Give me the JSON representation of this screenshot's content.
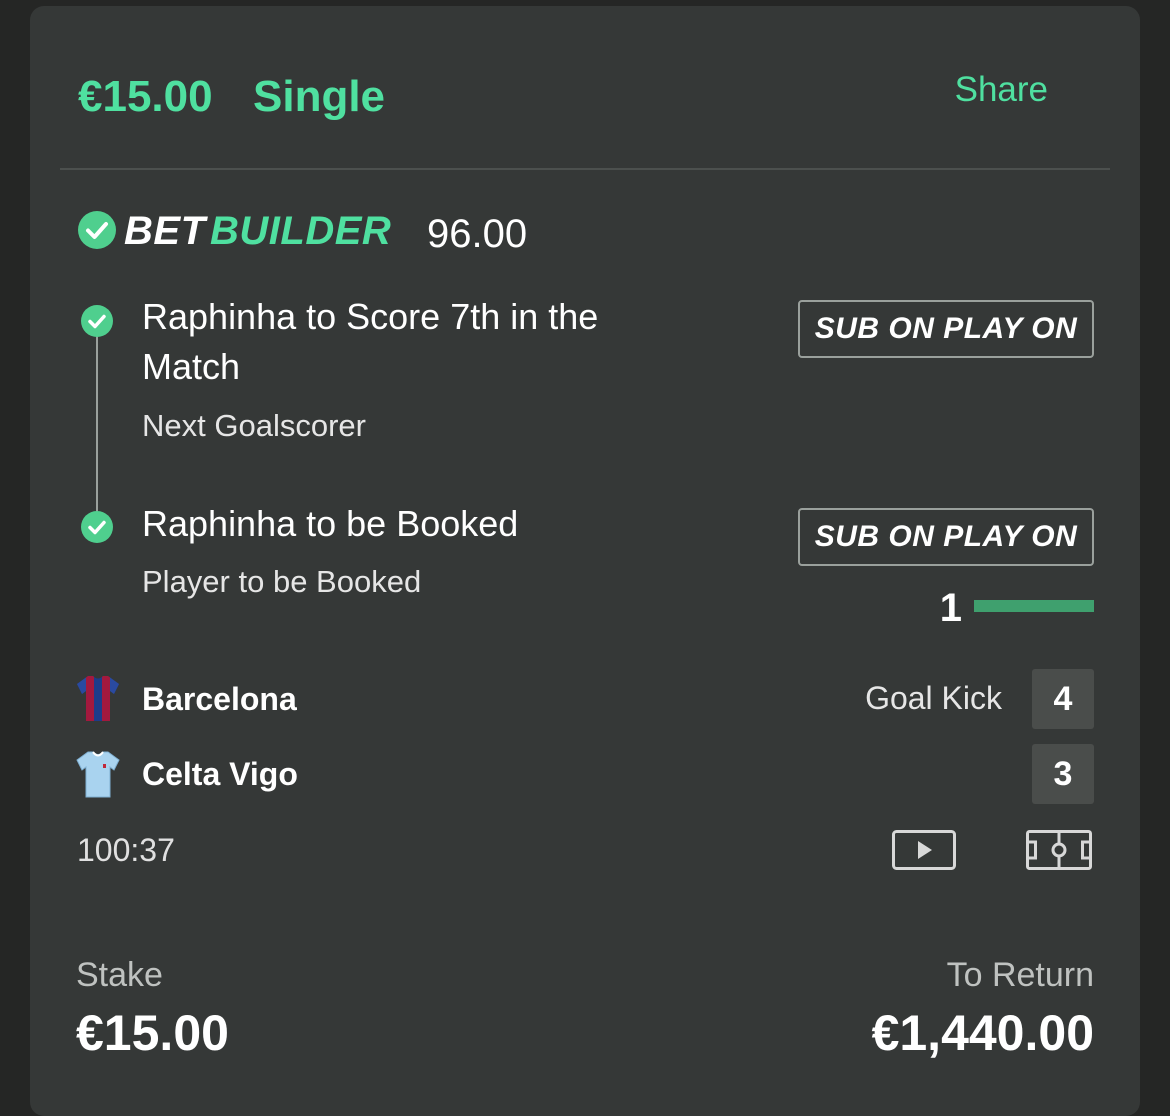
{
  "header": {
    "amount": "€15.00",
    "bet_type": "Single",
    "share_label": "Share"
  },
  "bet_builder": {
    "label_bet": "BET",
    "label_builder": "BUILDER",
    "odds": "96.00"
  },
  "legs": [
    {
      "title": "Raphinha to Score 7th in the Match",
      "market": "Next Goalscorer",
      "action_label": "SUB ON PLAY ON"
    },
    {
      "title": "Raphinha to be Booked",
      "market": "Player to be Booked",
      "action_label": "SUB ON PLAY ON"
    }
  ],
  "progress": {
    "count": "1",
    "fraction": 1.0
  },
  "match": {
    "home": {
      "name": "Barcelona",
      "score": "4",
      "kit_icon": "barcelona-kit-icon"
    },
    "away": {
      "name": "Celta Vigo",
      "score": "3",
      "kit_icon": "celta-vigo-kit-icon"
    },
    "last_event": "Goal Kick",
    "clock": "100:37"
  },
  "footer": {
    "stake_label": "Stake",
    "stake_value": "€15.00",
    "return_label": "To Return",
    "return_value": "€1,440.00"
  },
  "colors": {
    "accent": "#4fe0a0",
    "check": "#4fcf8e",
    "card": "#353837",
    "progress": "#3fa06e"
  }
}
